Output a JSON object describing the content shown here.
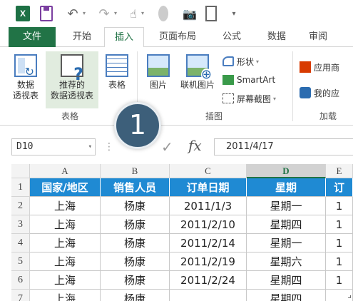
{
  "qat": {
    "app_logo": "X",
    "icons": [
      "excel-logo-icon",
      "save-icon",
      "undo-icon",
      "redo-icon",
      "touch-mode-icon",
      "circle-icon",
      "camera-icon",
      "form-icon",
      "customize-qat-icon"
    ]
  },
  "tabs": [
    {
      "label": "文件"
    },
    {
      "label": "开始"
    },
    {
      "label": "插入"
    },
    {
      "label": "页面布局"
    },
    {
      "label": "公式"
    },
    {
      "label": "数据"
    },
    {
      "label": "审阅"
    }
  ],
  "ribbon": {
    "pivot_line1": "数据",
    "pivot_line2": "透视表",
    "rec_line1": "推荐的",
    "rec_line2": "数据透视表",
    "table": "表格",
    "group_tables": "表格",
    "picture": "图片",
    "online_picture": "联机图片",
    "shapes": "形状",
    "smartart": "SmartArt",
    "screenshot": "屏幕截图",
    "group_illustrations": "插图",
    "apps": "应用商",
    "my_apps": "我的应",
    "group_addins": "加载"
  },
  "step_marker": "1",
  "formula_bar": {
    "name_box": "D10",
    "cancel_icon": "✕",
    "enter_icon": "✓",
    "fx": "fx",
    "value": "2011/4/17"
  },
  "grid": {
    "columns": [
      "A",
      "B",
      "C",
      "D",
      "E"
    ],
    "active_column": "D",
    "rows": [
      {
        "num": "1",
        "cells": [
          "国家/地区",
          "销售人员",
          "订单日期",
          "星期",
          "订"
        ]
      },
      {
        "num": "2",
        "cells": [
          "上海",
          "杨康",
          "2011/1/3",
          "星期一",
          "1"
        ]
      },
      {
        "num": "3",
        "cells": [
          "上海",
          "杨康",
          "2011/2/10",
          "星期四",
          "1"
        ]
      },
      {
        "num": "4",
        "cells": [
          "上海",
          "杨康",
          "2011/2/14",
          "星期一",
          "1"
        ]
      },
      {
        "num": "5",
        "cells": [
          "上海",
          "杨康",
          "2011/2/19",
          "星期六",
          "1"
        ]
      },
      {
        "num": "6",
        "cells": [
          "上海",
          "杨康",
          "2011/2/24",
          "星期四",
          "1"
        ]
      },
      {
        "num": "7",
        "cells": [
          "上海",
          "杨康",
          "",
          "星期四",
          ""
        ]
      }
    ]
  },
  "colors": {
    "excel_green": "#217346",
    "header_blue": "#1f8ad3",
    "step_marker": "#3d5f7a"
  }
}
